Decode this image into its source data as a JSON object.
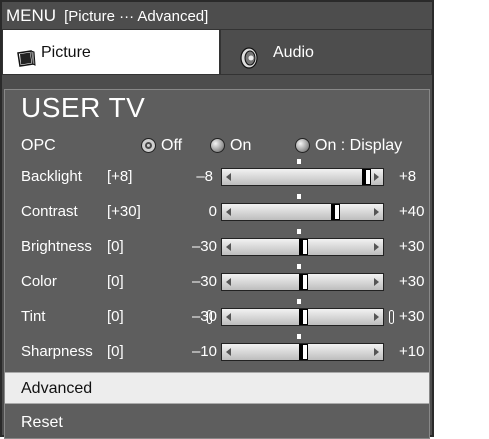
{
  "menu": {
    "title": "MENU",
    "breadcrumb": "[Picture ··· Advanced]"
  },
  "tabs": [
    {
      "label": "Picture",
      "icon": "picture-icon",
      "selected": true
    },
    {
      "label": "Audio",
      "icon": "audio-icon",
      "selected": false
    }
  ],
  "panel": {
    "title": "USER TV",
    "opc": {
      "label": "OPC",
      "options": [
        {
          "label": "Off",
          "selected": true
        },
        {
          "label": "On",
          "selected": false
        },
        {
          "label": "On : Display",
          "selected": false
        }
      ]
    },
    "settings": [
      {
        "label": "Backlight",
        "current": "[+8]",
        "min": "–8",
        "max": "+8",
        "min_value": -8,
        "max_value": 8,
        "value": 8
      },
      {
        "label": "Contrast",
        "current": "[+30]",
        "min": "0",
        "max": "+40",
        "min_value": 0,
        "max_value": 40,
        "value": 30
      },
      {
        "label": "Brightness",
        "current": "[0]",
        "min": "–30",
        "max": "+30",
        "min_value": -30,
        "max_value": 30,
        "value": 0
      },
      {
        "label": "Color",
        "current": "[0]",
        "min": "–30",
        "max": "+30",
        "min_value": -30,
        "max_value": 30,
        "value": 0
      },
      {
        "label": "Tint",
        "current": "[0]",
        "min": "–30",
        "max": "+30",
        "min_value": -30,
        "max_value": 30,
        "value": 0,
        "end_markers": true
      },
      {
        "label": "Sharpness",
        "current": "[0]",
        "min": "–10",
        "max": "+10",
        "min_value": -10,
        "max_value": 10,
        "value": 0
      }
    ],
    "advanced_label": "Advanced",
    "reset_label": "Reset"
  }
}
